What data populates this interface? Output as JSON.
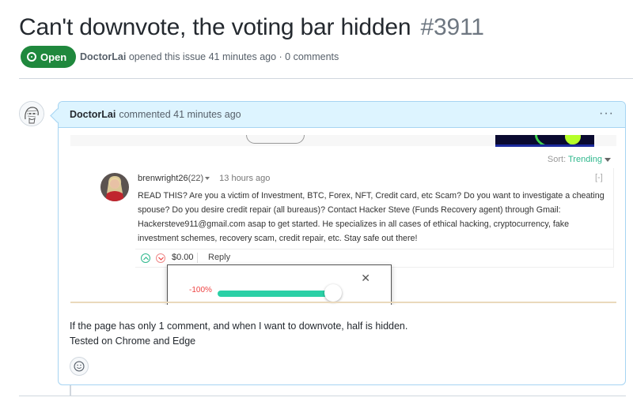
{
  "issue": {
    "title": "Can't downvote, the voting bar hidden",
    "number": "#3911",
    "state": "Open",
    "author": "DoctorLai",
    "meta_text": "opened this issue 41 minutes ago · 0 comments"
  },
  "comment": {
    "author": "DoctorLai",
    "header_text": "commented 41 minutes ago",
    "menu_label": "···",
    "body_lines": [
      "If the page has only 1 comment, and when I want to downvote, half is hidden.",
      "Tested on Chrome and Edge"
    ]
  },
  "screenshot": {
    "sort_label": "Sort:",
    "sort_value": "Trending",
    "collapse_label": "[-]",
    "reply": {
      "username": "brenwright26",
      "reputation": "(22)",
      "time": "13 hours ago",
      "body": "READ THIS? Are you a victim of Investment, BTC, Forex, NFT, Credit card, etc Scam? Do you want to investigate a cheating spouse? Do you desire credit repair (all bureaus)? Contact Hacker Steve (Funds Recovery agent) through Gmail: Hackersteve911@gmail.com asap to get started. He specializes in all cases of ethical hacking, cryptocurrency, fake investment schemes, recovery scam, credit repair, etc. Stay safe out there!",
      "amount": "$0.00",
      "reply_label": "Reply"
    },
    "vote_popup": {
      "percent_label": "-100%",
      "slider_value": 100,
      "close_label": "✕"
    }
  },
  "colors": {
    "open_green": "#1f883d",
    "header_blue": "#ddf4ff",
    "slider_teal": "#2ad0a6",
    "downvote_red": "#e44444"
  }
}
